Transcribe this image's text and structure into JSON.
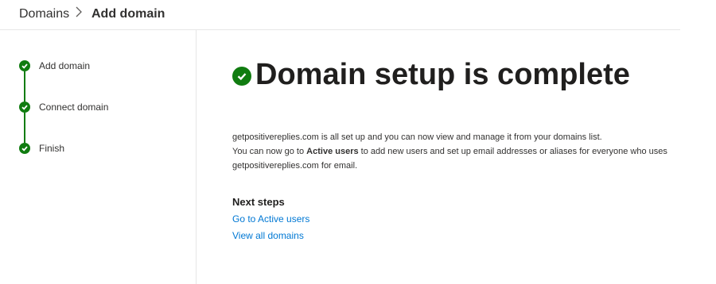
{
  "breadcrumb": {
    "root": "Domains",
    "separator": "›",
    "current": "Add domain"
  },
  "steps": [
    {
      "label": "Add domain",
      "status": "complete",
      "icon": "check-circle-icon"
    },
    {
      "label": "Connect domain",
      "status": "complete",
      "icon": "check-circle-icon"
    },
    {
      "label": "Finish",
      "status": "complete",
      "icon": "check-circle-icon"
    }
  ],
  "main": {
    "title": "Domain setup is complete",
    "title_icon": "check-circle-icon",
    "line1": "getpositivereplies.com is all set up and you can now view and manage it from your domains list.",
    "line2_pre": "You can now go to ",
    "line2_bold": "Active users",
    "line2_post": " to add new users and set up email addresses or aliases for everyone who uses",
    "line3": "getpositivereplies.com for email.",
    "next_steps_heading": "Next steps",
    "links": [
      "Go to Active users",
      "View all domains"
    ]
  },
  "colors": {
    "success": "#107c10",
    "link": "#0078d4",
    "text": "#323130"
  }
}
